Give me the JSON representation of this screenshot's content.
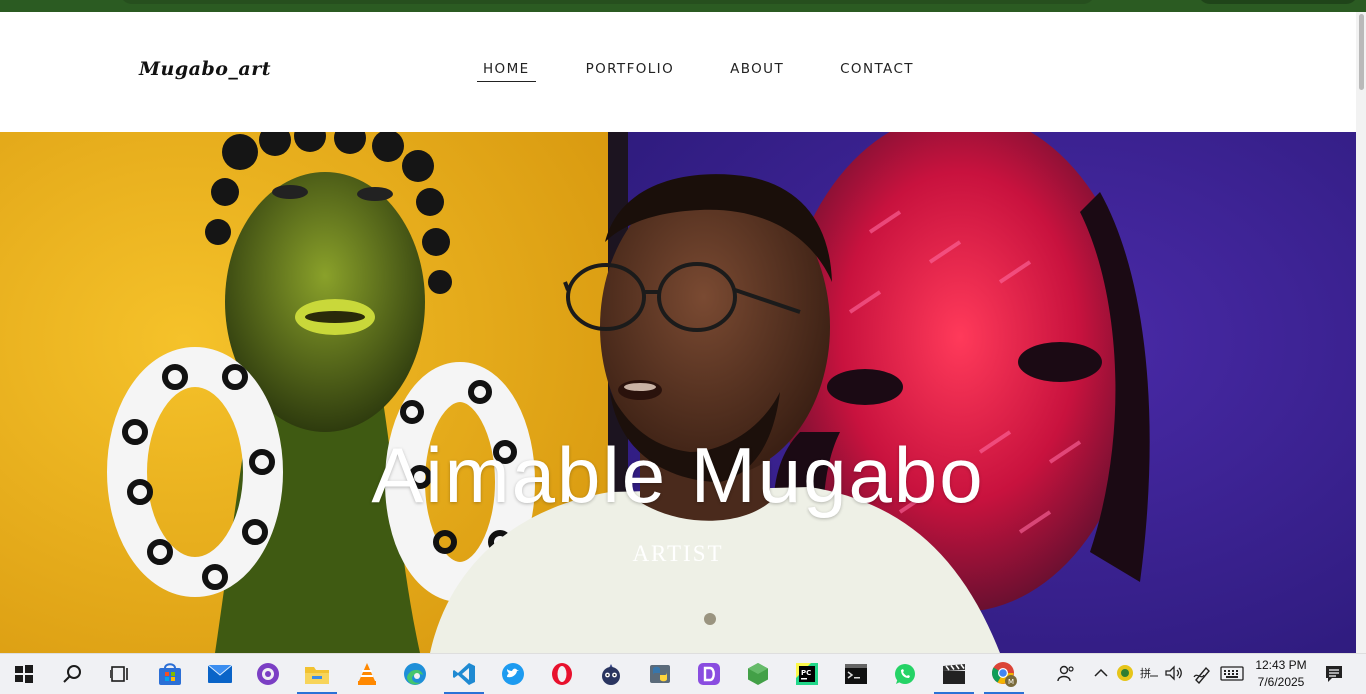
{
  "site": {
    "logo": "Mugabo_art",
    "nav": [
      {
        "label": "HOME",
        "active": true
      },
      {
        "label": "PORTFOLIO",
        "active": false
      },
      {
        "label": "ABOUT",
        "active": false
      },
      {
        "label": "CONTACT",
        "active": false
      }
    ],
    "hero": {
      "name": "Aimable Mugabo",
      "role": "ARTIST"
    }
  },
  "taskbar": {
    "apps": [
      "start-icon",
      "search-icon",
      "task-view-icon",
      "microsoft-store-icon",
      "mail-icon",
      "github-desktop-icon",
      "file-explorer-icon",
      "vlc-icon",
      "edge-icon",
      "vscode-icon",
      "twitter-icon",
      "opera-icon",
      "bot-app-icon",
      "python-icon",
      "dolby-access-icon",
      "nodejs-icon",
      "pycharm-icon",
      "terminal-icon",
      "whatsapp-icon",
      "clapperboard-icon",
      "chrome-icon"
    ],
    "active_apps": [
      "file-explorer-icon",
      "vscode-icon",
      "clapperboard-icon",
      "chrome-icon"
    ],
    "clock": {
      "time": "12:43 PM",
      "date": "7/6/2025"
    }
  }
}
